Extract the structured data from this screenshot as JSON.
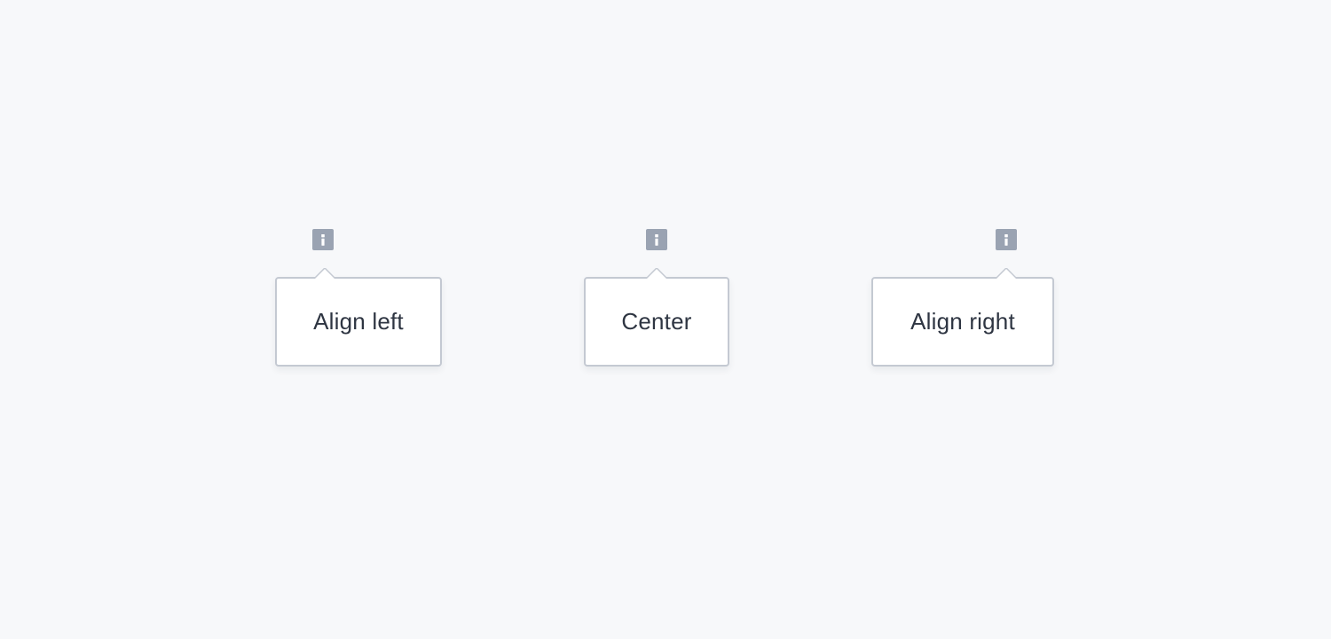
{
  "colors": {
    "background": "#f7f8fa",
    "icon_fill": "#9aa3b2",
    "tooltip_border": "#c4c9d2",
    "tooltip_text": "#2e3542"
  },
  "tooltips": [
    {
      "label": "Align left",
      "icon": "info-icon"
    },
    {
      "label": "Center",
      "icon": "info-icon"
    },
    {
      "label": "Align right",
      "icon": "info-icon"
    }
  ]
}
